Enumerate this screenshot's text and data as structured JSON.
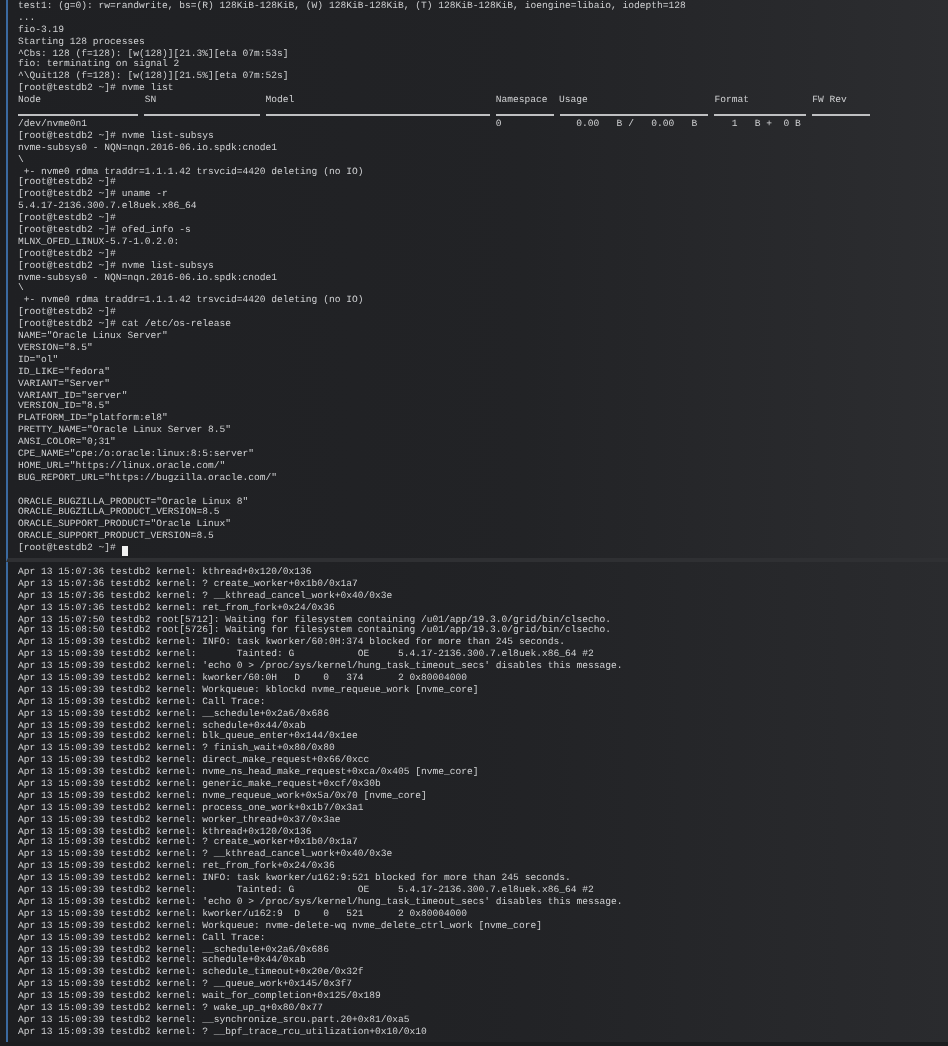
{
  "top_pane": {
    "lines_before": [
      "test1: (g=0): rw=randwrite, bs=(R) 128KiB-128KiB, (W) 128KiB-128KiB, (T) 128KiB-128KiB, ioengine=libaio, iodepth=128",
      "...",
      "fio-3.19",
      "Starting 128 processes",
      "^Cbs: 128 (f=128): [w(128)][21.3%][eta 07m:53s]",
      "fio: terminating on signal 2",
      "^\\Quit128 (f=128): [w(128)][21.5%][eta 07m:52s]",
      "[root@testdb2 ~]# nvme list"
    ],
    "nvme_table": {
      "columns": [
        "Node",
        "SN",
        "Model",
        "Namespace",
        "Usage",
        "Format",
        "FW Rev"
      ],
      "rows": [
        {
          "node": "/dev/nvme0n1",
          "namespace": "0",
          "usage": "0.00   B /   0.00   B",
          "format": "1   B +  0 B"
        }
      ]
    },
    "lines_after": [
      {
        "kind": "text",
        "text": "[root@testdb2 ~]# nvme list-subsys"
      },
      {
        "kind": "text",
        "text": "nvme-subsys0 - NQN=nqn.2016-06.io.spdk:cnode1"
      },
      {
        "kind": "text",
        "text": "\\"
      },
      {
        "kind": "text",
        "text": " +- nvme0 rdma traddr=1.1.1.42 trsvcid=4420 deleting (no IO)"
      },
      {
        "kind": "text",
        "text": "[root@testdb2 ~]#"
      },
      {
        "kind": "text",
        "text": "[root@testdb2 ~]# uname -r"
      },
      {
        "kind": "text",
        "text": "5.4.17-2136.300.7.el8uek.x86_64"
      },
      {
        "kind": "text",
        "text": "[root@testdb2 ~]#"
      },
      {
        "kind": "text",
        "text": "[root@testdb2 ~]# ofed_info -s"
      },
      {
        "kind": "text",
        "text": "MLNX_OFED_LINUX-5.7-1.0.2.0:"
      },
      {
        "kind": "text",
        "text": "[root@testdb2 ~]#"
      },
      {
        "kind": "text",
        "text": "[root@testdb2 ~]# nvme list-subsys"
      },
      {
        "kind": "text",
        "text": "nvme-subsys0 - NQN=nqn.2016-06.io.spdk:cnode1"
      },
      {
        "kind": "text",
        "text": "\\"
      },
      {
        "kind": "text",
        "text": " +- nvme0 rdma traddr=1.1.1.42 trsvcid=4420 deleting (no IO)"
      },
      {
        "kind": "text",
        "text": "[root@testdb2 ~]#"
      },
      {
        "kind": "text",
        "text": "[root@testdb2 ~]# cat /etc/os-release"
      },
      {
        "kind": "text",
        "text": "NAME=\"Oracle Linux Server\""
      },
      {
        "kind": "text",
        "text": "VERSION=\"8.5\""
      },
      {
        "kind": "text",
        "text": "ID=\"ol\""
      },
      {
        "kind": "text",
        "text": "ID_LIKE=\"fedora\""
      },
      {
        "kind": "text",
        "text": "VARIANT=\"Server\""
      },
      {
        "kind": "text",
        "text": "VARIANT_ID=\"server\""
      },
      {
        "kind": "text",
        "text": "VERSION_ID=\"8.5\""
      },
      {
        "kind": "text",
        "text": "PLATFORM_ID=\"platform:el8\""
      },
      {
        "kind": "text",
        "text": "PRETTY_NAME=\"Oracle Linux Server 8.5\""
      },
      {
        "kind": "text",
        "text": "ANSI_COLOR=\"0;31\""
      },
      {
        "kind": "text",
        "text": "CPE_NAME=\"cpe:/o:oracle:linux:8:5:server\""
      },
      {
        "kind": "text",
        "text": "HOME_URL=\"https://linux.oracle.com/\""
      },
      {
        "kind": "text",
        "text": "BUG_REPORT_URL=\"https://bugzilla.oracle.com/\""
      },
      {
        "kind": "blank"
      },
      {
        "kind": "text",
        "text": "ORACLE_BUGZILLA_PRODUCT=\"Oracle Linux 8\""
      },
      {
        "kind": "text",
        "text": "ORACLE_BUGZILLA_PRODUCT_VERSION=8.5"
      },
      {
        "kind": "text",
        "text": "ORACLE_SUPPORT_PRODUCT=\"Oracle Linux\""
      },
      {
        "kind": "text",
        "text": "ORACLE_SUPPORT_PRODUCT_VERSION=8.5"
      }
    ],
    "prompt": "[root@testdb2 ~]#",
    "cursor": true
  },
  "bottom_pane": {
    "log_lines": [
      "Apr 13 15:07:36 testdb2 kernel: kthread+0x120/0x136",
      "Apr 13 15:07:36 testdb2 kernel: ? create_worker+0x1b0/0x1a7",
      "Apr 13 15:07:36 testdb2 kernel: ? __kthread_cancel_work+0x40/0x3e",
      "Apr 13 15:07:36 testdb2 kernel: ret_from_fork+0x24/0x36",
      "Apr 13 15:07:50 testdb2 root[5712]: Waiting for filesystem containing /u01/app/19.3.0/grid/bin/clsecho.",
      "Apr 13 15:08:50 testdb2 root[5726]: Waiting for filesystem containing /u01/app/19.3.0/grid/bin/clsecho.",
      "Apr 13 15:09:39 testdb2 kernel: INFO: task kworker/60:0H:374 blocked for more than 245 seconds.",
      "Apr 13 15:09:39 testdb2 kernel:       Tainted: G           OE     5.4.17-2136.300.7.el8uek.x86_64 #2",
      "Apr 13 15:09:39 testdb2 kernel: 'echo 0 > /proc/sys/kernel/hung_task_timeout_secs' disables this message.",
      "Apr 13 15:09:39 testdb2 kernel: kworker/60:0H   D    0   374      2 0x80004000",
      "Apr 13 15:09:39 testdb2 kernel: Workqueue: kblockd nvme_requeue_work [nvme_core]",
      "Apr 13 15:09:39 testdb2 kernel: Call Trace:",
      "Apr 13 15:09:39 testdb2 kernel: __schedule+0x2a6/0x686",
      "Apr 13 15:09:39 testdb2 kernel: schedule+0x44/0xab",
      "Apr 13 15:09:39 testdb2 kernel: blk_queue_enter+0x144/0x1ee",
      "Apr 13 15:09:39 testdb2 kernel: ? finish_wait+0x80/0x80",
      "Apr 13 15:09:39 testdb2 kernel: direct_make_request+0x66/0xcc",
      "Apr 13 15:09:39 testdb2 kernel: nvme_ns_head_make_request+0xca/0x405 [nvme_core]",
      "Apr 13 15:09:39 testdb2 kernel: generic_make_request+0xcf/0x30b",
      "Apr 13 15:09:39 testdb2 kernel: nvme_requeue_work+0x5a/0x70 [nvme_core]",
      "Apr 13 15:09:39 testdb2 kernel: process_one_work+0x1b7/0x3a1",
      "Apr 13 15:09:39 testdb2 kernel: worker_thread+0x37/0x3ae",
      "Apr 13 15:09:39 testdb2 kernel: kthread+0x120/0x136",
      "Apr 13 15:09:39 testdb2 kernel: ? create_worker+0x1b0/0x1a7",
      "Apr 13 15:09:39 testdb2 kernel: ? __kthread_cancel_work+0x40/0x3e",
      "Apr 13 15:09:39 testdb2 kernel: ret_from_fork+0x24/0x36",
      "Apr 13 15:09:39 testdb2 kernel: INFO: task kworker/u162:9:521 blocked for more than 245 seconds.",
      "Apr 13 15:09:39 testdb2 kernel:       Tainted: G           OE     5.4.17-2136.300.7.el8uek.x86_64 #2",
      "Apr 13 15:09:39 testdb2 kernel: 'echo 0 > /proc/sys/kernel/hung_task_timeout_secs' disables this message.",
      "Apr 13 15:09:39 testdb2 kernel: kworker/u162:9  D    0   521      2 0x80004000",
      "Apr 13 15:09:39 testdb2 kernel: Workqueue: nvme-delete-wq nvme_delete_ctrl_work [nvme_core]",
      "Apr 13 15:09:39 testdb2 kernel: Call Trace:",
      "Apr 13 15:09:39 testdb2 kernel: __schedule+0x2a6/0x686",
      "Apr 13 15:09:39 testdb2 kernel: schedule+0x44/0xab",
      "Apr 13 15:09:39 testdb2 kernel: schedule_timeout+0x20e/0x32f",
      "Apr 13 15:09:39 testdb2 kernel: ? __queue_work+0x145/0x3f7",
      "Apr 13 15:09:39 testdb2 kernel: wait_for_completion+0x125/0x189",
      "Apr 13 15:09:39 testdb2 kernel: ? wake_up_q+0x80/0x77",
      "Apr 13 15:09:39 testdb2 kernel: __synchronize_srcu.part.20+0x81/0xa5",
      "Apr 13 15:09:39 testdb2 kernel: ? __bpf_trace_rcu_utilization+0x10/0x10"
    ]
  }
}
